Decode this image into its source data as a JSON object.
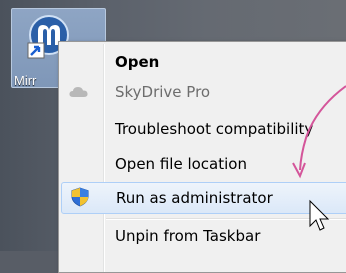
{
  "desktop": {
    "shortcut_label": "Mirr",
    "shortcut_icon": "app-shortcut-icon"
  },
  "context_menu": {
    "items": [
      {
        "label": "Open",
        "style": "bold",
        "icon": ""
      },
      {
        "label": "SkyDrive Pro",
        "style": "disabled",
        "icon": "cloud-icon"
      },
      {
        "label": "Troubleshoot compatibility",
        "style": "normal",
        "icon": ""
      },
      {
        "label": "Open file location",
        "style": "normal",
        "icon": ""
      },
      {
        "label": "Run as administrator",
        "style": "hover",
        "icon": "uac-shield-icon"
      },
      {
        "label": "Unpin from Taskbar",
        "style": "normal",
        "icon": ""
      }
    ]
  },
  "annotation": {
    "arrow_color": "#d4559a"
  },
  "colors": {
    "menu_bg": "#f0f0f0",
    "hover_border": "#aecff7",
    "shield_blue": "#2f6fd6",
    "shield_yellow": "#f2c230"
  }
}
